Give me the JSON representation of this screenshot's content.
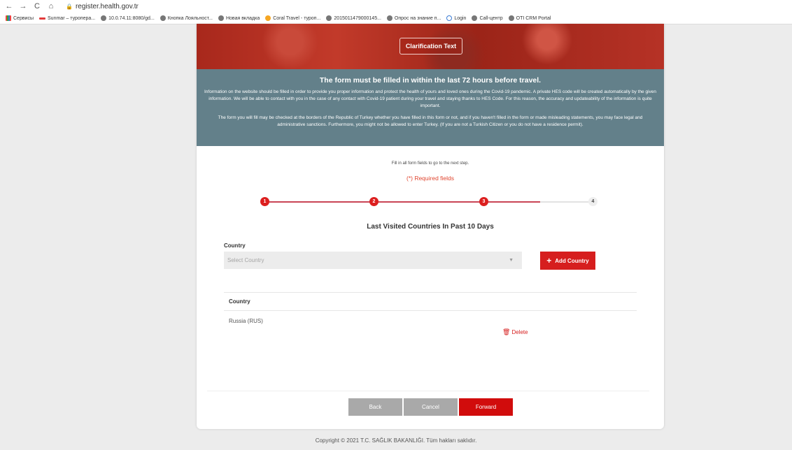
{
  "browser": {
    "url": "register.health.gov.tr",
    "bookmarks": [
      {
        "label": "Сервисы",
        "icon": "apps-icon"
      },
      {
        "label": "Sunmar – туропера...",
        "icon": "sunmar-icon"
      },
      {
        "label": "10.0.74.11:8080/gd...",
        "icon": "globe-icon"
      },
      {
        "label": "Кнопка Лояльност...",
        "icon": "globe-icon"
      },
      {
        "label": "Новая вкладка",
        "icon": "globe-icon"
      },
      {
        "label": "Coral Travel - туроп...",
        "icon": "coral-icon"
      },
      {
        "label": "2015011479000145...",
        "icon": "globe-icon"
      },
      {
        "label": "Опрос на знание п...",
        "icon": "globe-icon"
      },
      {
        "label": "Login",
        "icon": "login-icon"
      },
      {
        "label": "Call-центр",
        "icon": "globe-icon"
      },
      {
        "label": "OTI CRM Portal",
        "icon": "globe-icon"
      }
    ]
  },
  "banner": {
    "clarification_label": "Clarification Text"
  },
  "info": {
    "title": "The form must be filled in within the last 72 hours before travel.",
    "paragraph1": "Information on the website should be filled in order to provide you proper information and protect the health of yours and loved ones during the Covid-19 pandemic. A private HES code will be created automatically by the given information. We will be able to contact with you in the case of any contact with Covid-19 patient during your travel and staying thanks to HES Code. For this reason, the accuracy and updateability of the information is quite important.",
    "paragraph2": "The form you will fill may be checked at the borders of the Republic of Turkey whether you have filled in this form or not, and if you haven't filled in the form or made misleading statements, you may face legal and administrative sanctions. Furthermore, you might not be allowed to enter Turkey. (If you are not a Turkish Citizen or you do not have a residence permit)."
  },
  "form": {
    "instruction": "Fill in all form fields to go to the next step.",
    "required_note": "(*) Required fields",
    "steps": [
      "1",
      "2",
      "3",
      "4"
    ],
    "current_step": 3,
    "progress_fraction": 0.84,
    "section_title": "Last Visited Countries In Past 10 Days",
    "country_label": "Country",
    "country_placeholder": "Select Country",
    "add_button": "Add Country",
    "table": {
      "header": "Country",
      "rows": [
        {
          "country": "Russia (RUS)",
          "action": "Delete"
        }
      ]
    },
    "buttons": {
      "back": "Back",
      "cancel": "Cancel",
      "forward": "Forward"
    }
  },
  "footer": {
    "copyright": "Copyright © 2021 T.C. SAĞLIK BAKANLIĞI. Tüm hakları saklıdır."
  },
  "colors": {
    "accent": "#d61e1e",
    "info_bg": "#63808a",
    "progress": "#c94455"
  }
}
